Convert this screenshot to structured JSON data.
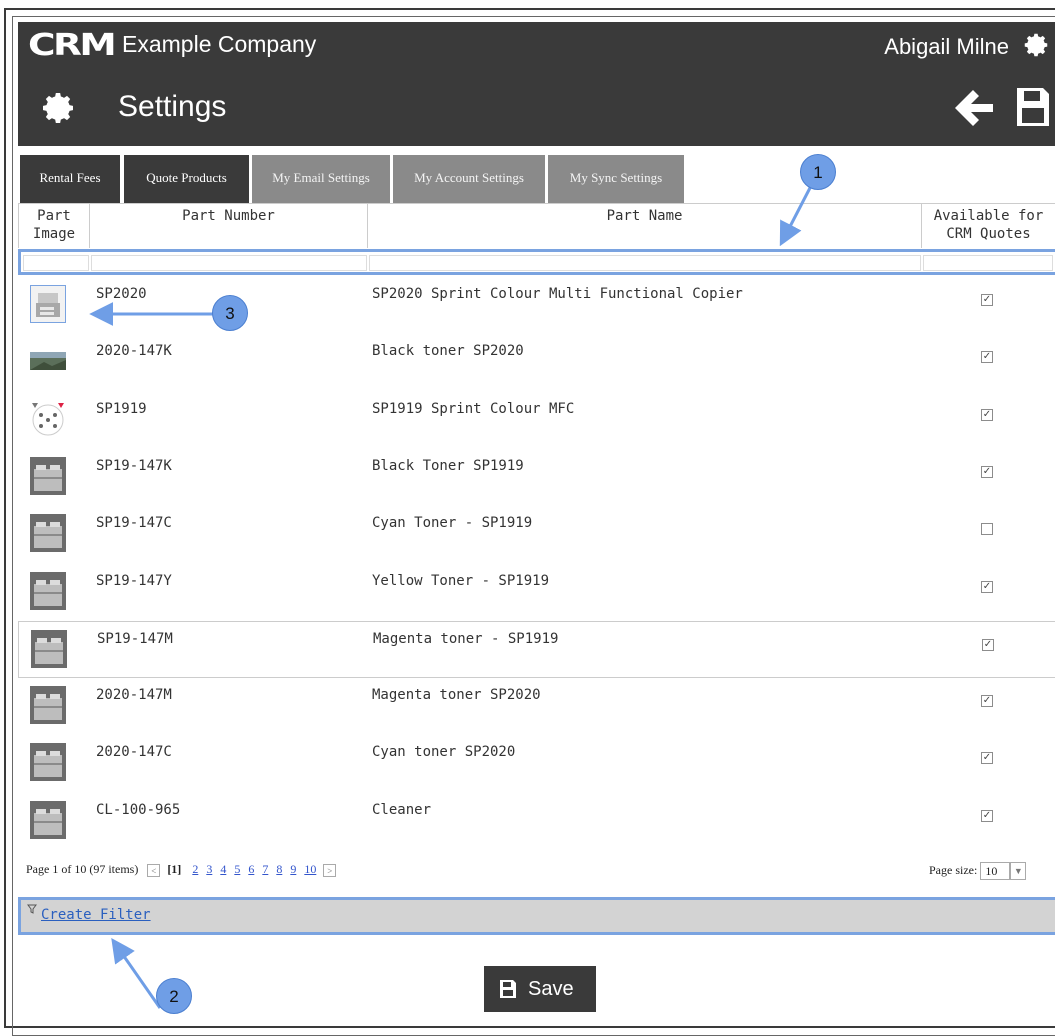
{
  "header": {
    "logo_text": "CRM",
    "company": "Example Company",
    "user": "Abigail Milne",
    "page_title": "Settings",
    "icons": [
      "gear-icon",
      "back-arrow-icon",
      "save-disk-icon"
    ]
  },
  "tabs": [
    {
      "label": "Rental Fees",
      "active": true
    },
    {
      "label": "Quote Products",
      "active": true
    },
    {
      "label": "My Email Settings",
      "active": false
    },
    {
      "label": "My Account Settings",
      "active": false
    },
    {
      "label": "My Sync Settings",
      "active": false
    }
  ],
  "grid": {
    "columns": {
      "image_line1": "Part",
      "image_line2": "Image",
      "number": "Part Number",
      "name": "Part Name",
      "available_line1": "Available for",
      "available_line2": "CRM Quotes"
    },
    "rows": [
      {
        "number": "SP2020",
        "name": "SP2020 Sprint Colour Multi Functional Copier",
        "available": true,
        "image": "copier-photo"
      },
      {
        "number": "2020-147K",
        "name": "Black toner SP2020",
        "available": true,
        "image": "landscape-photo"
      },
      {
        "number": "SP1919",
        "name": "SP1919 Sprint Colour MFC",
        "available": true,
        "image": "dotted-circle-photo"
      },
      {
        "number": "SP19-147K",
        "name": "Black Toner SP1919",
        "available": true,
        "image": "placeholder-box"
      },
      {
        "number": "SP19-147C",
        "name": "Cyan Toner - SP1919",
        "available": false,
        "image": "placeholder-box"
      },
      {
        "number": "SP19-147Y",
        "name": "Yellow Toner - SP1919",
        "available": true,
        "image": "placeholder-box"
      },
      {
        "number": "SP19-147M",
        "name": "Magenta toner - SP1919",
        "available": true,
        "image": "placeholder-box"
      },
      {
        "number": "2020-147M",
        "name": "Magenta toner SP2020",
        "available": true,
        "image": "placeholder-box"
      },
      {
        "number": "2020-147C",
        "name": "Cyan toner SP2020",
        "available": true,
        "image": "placeholder-box"
      },
      {
        "number": "CL-100-965",
        "name": "Cleaner",
        "available": true,
        "image": "placeholder-box"
      }
    ]
  },
  "pager": {
    "summary": "Page 1 of 10 (97 items)",
    "current": "[1]",
    "pages": [
      "2",
      "3",
      "4",
      "5",
      "6",
      "7",
      "8",
      "9",
      "10"
    ],
    "page_size_label": "Page size:",
    "page_size": "10"
  },
  "filter": {
    "label": "Create Filter"
  },
  "save_button": {
    "label": "Save"
  },
  "callouts": [
    "1",
    "2",
    "3"
  ],
  "colors": {
    "dark_bar": "#3a3a3a",
    "tab_inactive": "#8a8a8a",
    "highlight": "#7aa3e0",
    "callout": "#6f9ee6",
    "link": "#2a5fbf"
  }
}
